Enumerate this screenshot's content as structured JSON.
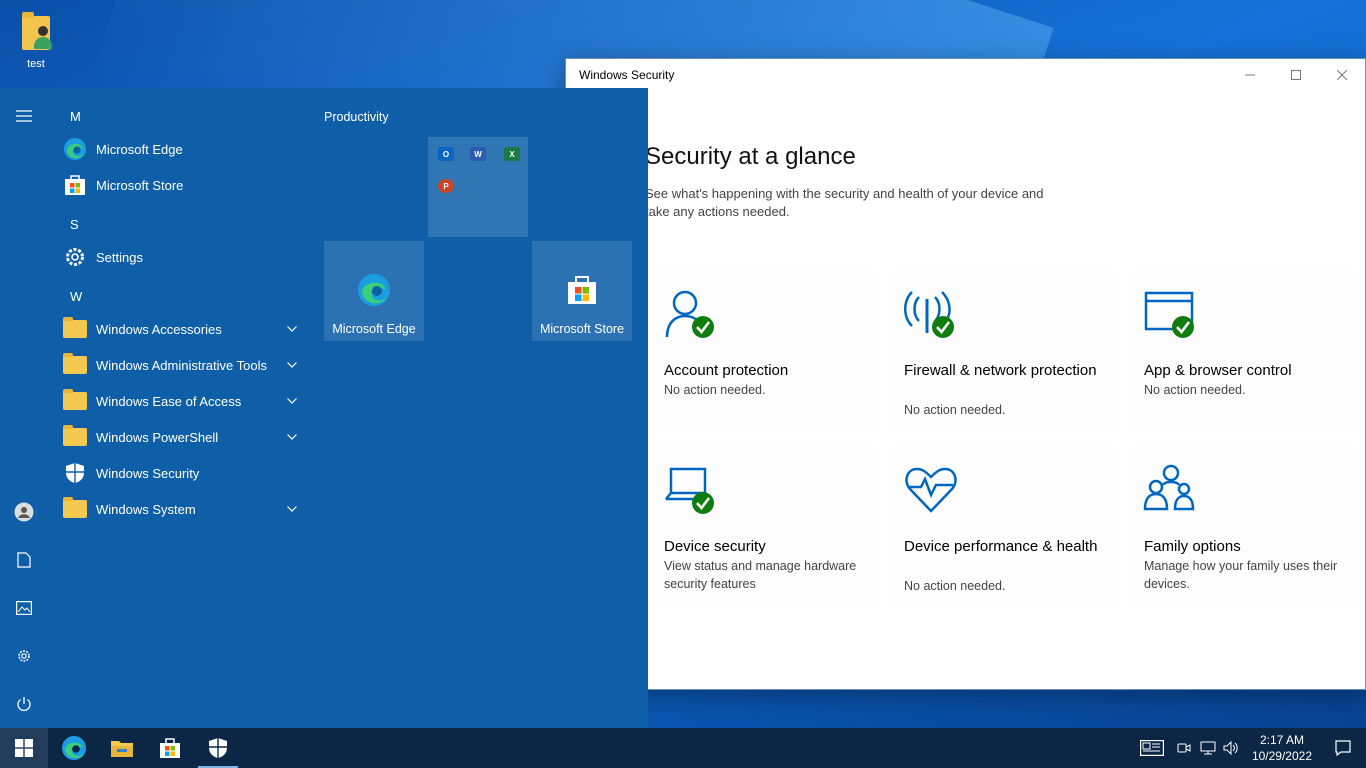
{
  "desktop": {
    "icons": [
      {
        "label": "test",
        "icon": "user-folder-icon"
      }
    ]
  },
  "window": {
    "title": "Windows Security",
    "heading": "Security at a glance",
    "subtext": "See what's happening with the security and health of your device and take any actions needed.",
    "cards": [
      {
        "title": "Account protection",
        "desc": "No action needed.",
        "icon": "account-icon",
        "ok": true
      },
      {
        "title": "Firewall & network protection",
        "desc": "No action needed.",
        "icon": "firewall-icon",
        "ok": true
      },
      {
        "title": "App & browser control",
        "desc": "No action needed.",
        "icon": "browser-window-icon",
        "ok": true
      },
      {
        "title": "Device security",
        "desc": "View status and manage hardware security features",
        "icon": "laptop-icon",
        "ok": true
      },
      {
        "title": "Device performance & health",
        "desc": "No action needed.",
        "icon": "heart-pulse-icon",
        "ok": false
      },
      {
        "title": "Family options",
        "desc": "Manage how your family uses their devices.",
        "icon": "family-icon",
        "ok": false
      }
    ]
  },
  "start_menu": {
    "sections": [
      {
        "letter": "M",
        "apps": [
          {
            "label": "Microsoft Edge",
            "icon": "edge-icon",
            "expandable": false
          },
          {
            "label": "Microsoft Store",
            "icon": "store-icon",
            "expandable": false
          }
        ]
      },
      {
        "letter": "S",
        "apps": [
          {
            "label": "Settings",
            "icon": "gear-icon",
            "expandable": false
          }
        ]
      },
      {
        "letter": "W",
        "apps": [
          {
            "label": "Windows Accessories",
            "icon": "folder-icon",
            "expandable": true
          },
          {
            "label": "Windows Administrative Tools",
            "icon": "folder-icon",
            "expandable": true
          },
          {
            "label": "Windows Ease of Access",
            "icon": "folder-icon",
            "expandable": true
          },
          {
            "label": "Windows PowerShell",
            "icon": "folder-icon",
            "expandable": true
          },
          {
            "label": "Windows Security",
            "icon": "shield-icon",
            "expandable": false
          },
          {
            "label": "Windows System",
            "icon": "folder-icon",
            "expandable": true
          }
        ]
      }
    ],
    "group_title": "Productivity",
    "folder_tile_apps": [
      "O",
      "W",
      "X",
      "P"
    ],
    "tiles": [
      {
        "label": "Microsoft Edge",
        "icon": "edge-icon"
      },
      {
        "label": "Microsoft Store",
        "icon": "store-icon"
      }
    ],
    "rail": [
      "hamburger-icon",
      "user-icon",
      "documents-icon",
      "pictures-icon",
      "settings-icon",
      "power-icon"
    ]
  },
  "taskbar": {
    "apps": [
      "windows-logo-icon",
      "edge-icon",
      "file-explorer-icon",
      "store-icon",
      "shield-icon"
    ],
    "time": "2:17 AM",
    "date": "10/29/2022"
  },
  "colors": {
    "accent": "#0f5fa8",
    "taskbar": "#0c2745",
    "security_blue": "#0067c0",
    "ok_green": "#107c10"
  }
}
